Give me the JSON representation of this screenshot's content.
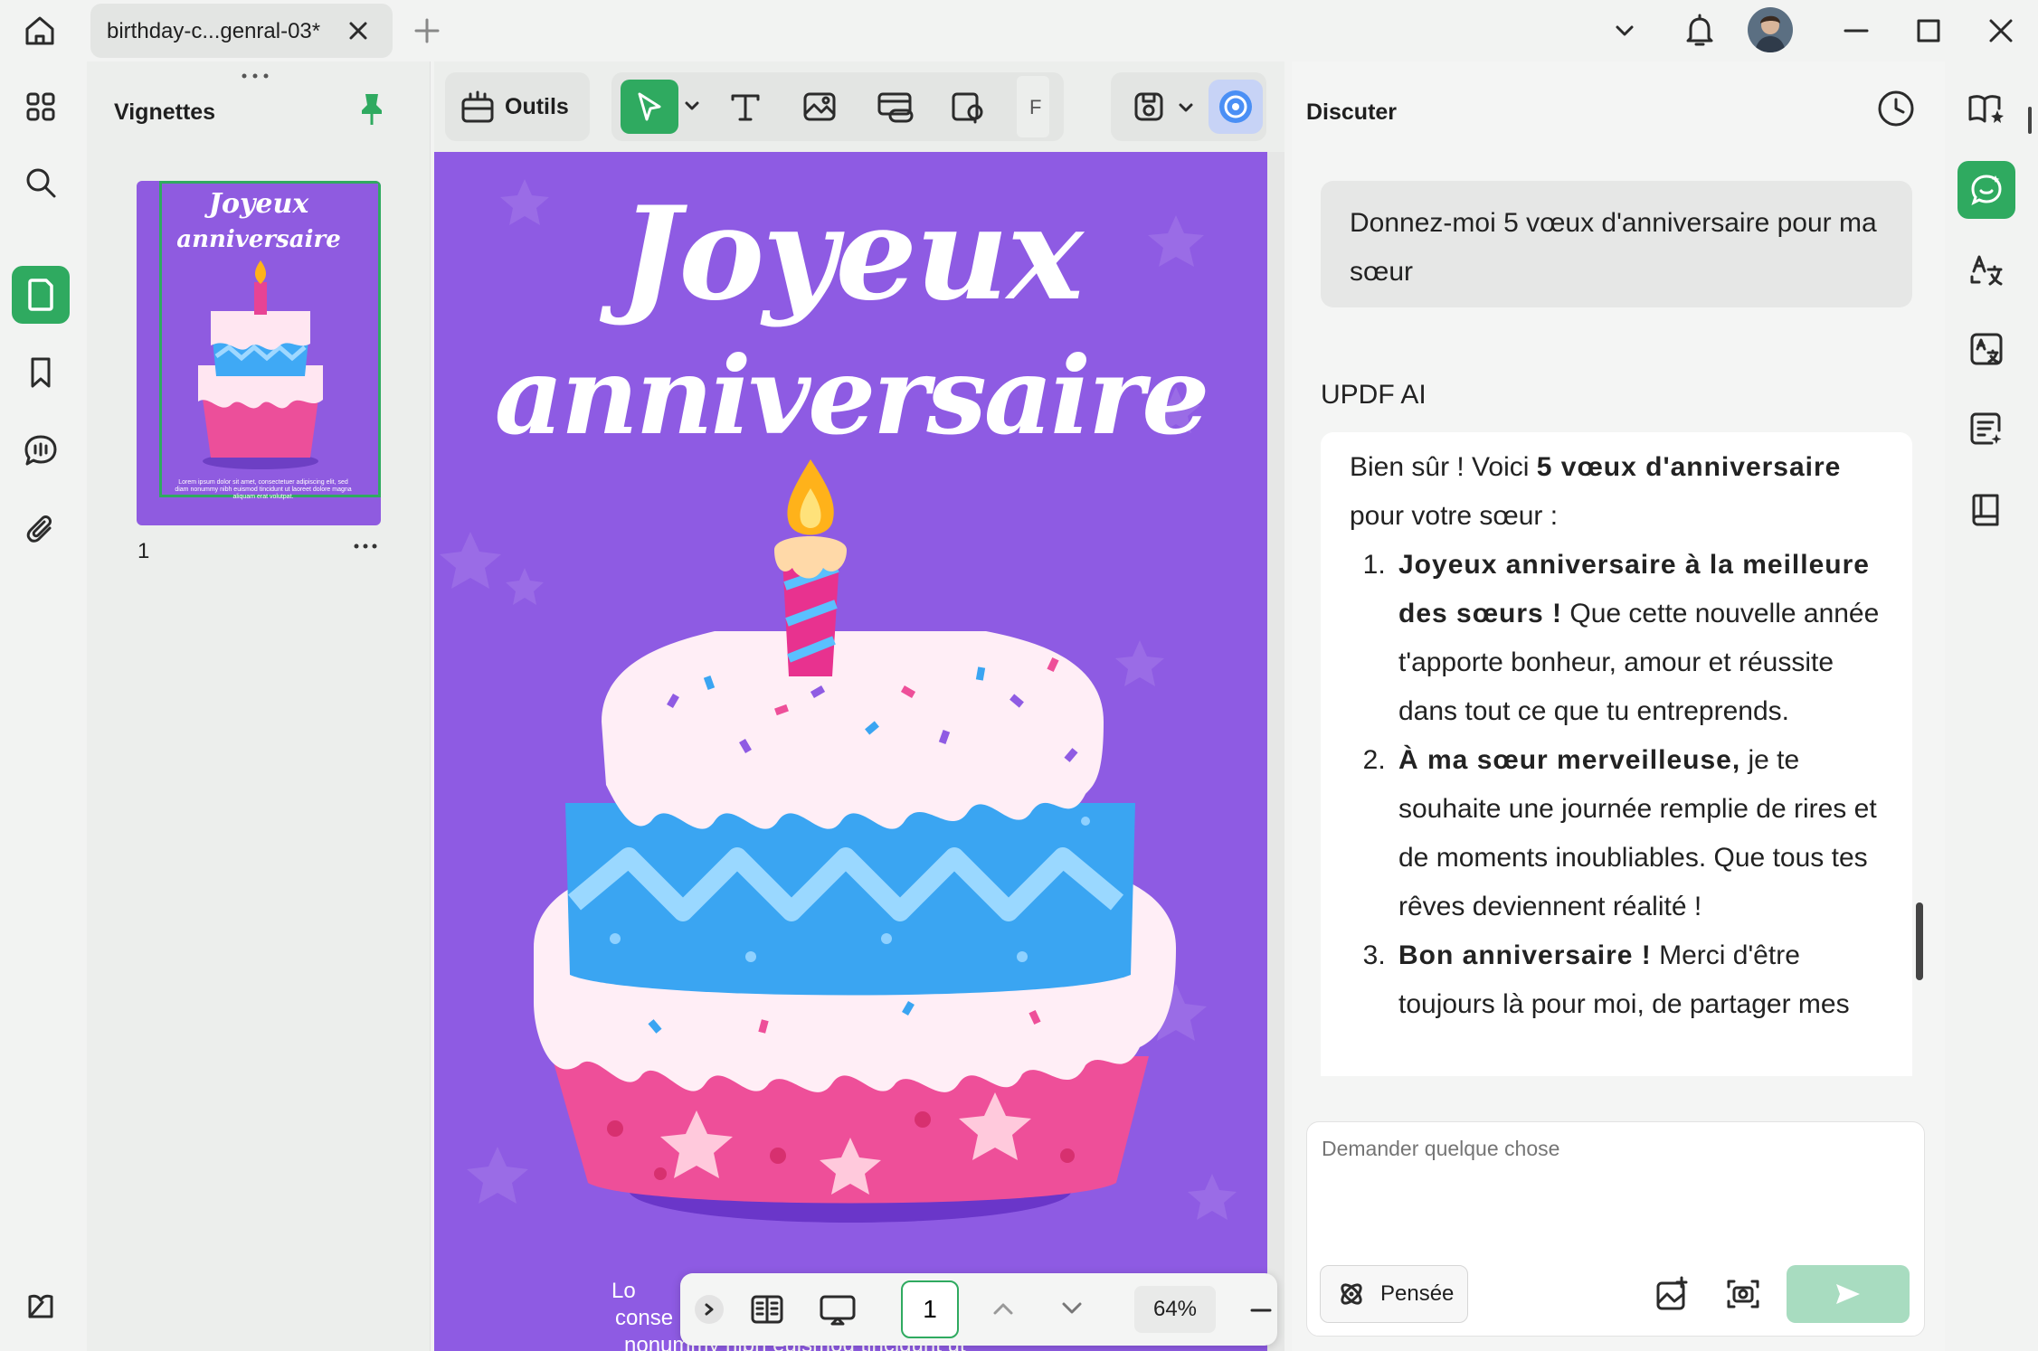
{
  "window": {
    "tab_title": "birthday-c...genral-03*"
  },
  "thumbnails": {
    "title": "Vignettes",
    "page_number": "1",
    "thumb_title_line1": "Joyeux",
    "thumb_title_line2": "anniversaire",
    "thumb_footer": "Lorem ipsum dolor sit amet, consectetuer adipiscing elit, sed diam nonummy nibh euismod tincidunt ut laoreet dolore magna aliquam erat volutpat."
  },
  "toolbar": {
    "tools_label": "Outils",
    "truncated_label": "F"
  },
  "document": {
    "title_line1": "Joyeux",
    "title_line2": "anniversaire",
    "footer_text_left": "Lo",
    "footer_text_line2": "conse",
    "footer_text_line3": "nonummy nibh euismod tincidunt ut"
  },
  "bottombar": {
    "page_input": "1",
    "zoom": "64%"
  },
  "chat": {
    "title": "Discuter",
    "user_message": "Donnez-moi 5 vœux d'anniversaire pour ma sœur",
    "ai_label": "UPDF AI",
    "ai_intro_prefix": "Bien sûr ! Voici ",
    "ai_intro_bold": "5 vœux d'anniversaire",
    "ai_intro_suffix": " pour votre sœur :",
    "wishes": [
      {
        "bold": "Joyeux anniversaire à la meilleure des sœurs !",
        "text": " Que cette nouvelle année t'apporte bonheur, amour et réussite dans tout ce que tu entreprends."
      },
      {
        "bold": "À ma sœur merveilleuse,",
        "text": " je te souhaite une journée remplie de rires et de moments inoubliables. Que tous tes rêves deviennent réalité !"
      },
      {
        "bold": "Bon anniversaire !",
        "text": " Merci d'être toujours là pour moi, de partager mes"
      }
    ],
    "input_placeholder": "Demander quelque chose",
    "pensee_label": "Pensée"
  },
  "colors": {
    "accent": "#2faa60",
    "page_bg": "#8e5be3",
    "send_disabled": "#a8dcc0"
  }
}
